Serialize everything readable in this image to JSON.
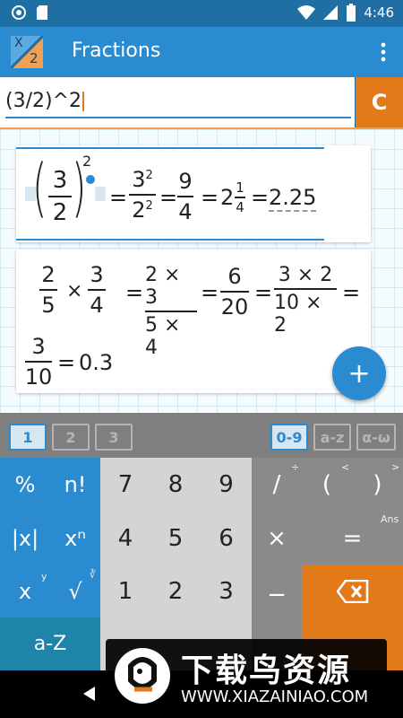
{
  "status": {
    "time": "4:46"
  },
  "app": {
    "title": "Fractions",
    "logo_x": "X",
    "logo_2": "2"
  },
  "input": {
    "value": "(3/2)^2",
    "clear_label": "C"
  },
  "result1": {
    "base_num": "3",
    "base_den": "2",
    "power": "2",
    "eq": "=",
    "step1_num_base": "3",
    "step1_num_pow": "2",
    "step1_den_base": "2",
    "step1_den_pow": "2",
    "step2_num": "9",
    "step2_den": "4",
    "mixed_whole": "2",
    "mixed_num": "1",
    "mixed_den": "4",
    "decimal": "2.25"
  },
  "result2": {
    "a_num": "2",
    "a_den": "5",
    "times": "×",
    "b_num": "3",
    "b_den": "4",
    "c_num": "2 × 3",
    "c_den": "5 × 4",
    "d_num": "6",
    "d_den": "20",
    "e_num": "3 × 2",
    "e_den": "10 × 2",
    "f_num": "3",
    "f_den": "10",
    "eq": "=",
    "decimal": "0.3"
  },
  "fab": {
    "label": "+"
  },
  "tabs": {
    "left": [
      "1",
      "2",
      "3"
    ],
    "right": [
      "0-9",
      "a-z",
      "α-ω"
    ]
  },
  "keys": {
    "percent": "%",
    "factorial": "n!",
    "abs": "|x|",
    "power": "xⁿ",
    "x": "x",
    "sqrt": "√",
    "sqrt_hint_y": "y",
    "sqrt_hint": "∛",
    "az": "a-Z",
    "d7": "7",
    "d8": "8",
    "d9": "9",
    "d4": "4",
    "d5": "5",
    "d6": "6",
    "d1": "1",
    "d2": "2",
    "d3": "3",
    "divide": "/",
    "divide_hint": "÷",
    "lparen": "(",
    "lparen_hint": "<",
    "rparen": ")",
    "rparen_hint": ">",
    "multiply": "×",
    "equals": "=",
    "ans_hint": "Ans",
    "minus": "−"
  },
  "watermark": {
    "title": "下载鸟资源",
    "url": "WWW.XIAZAINIAO.COM"
  },
  "colors": {
    "primary": "#2a8bd1",
    "primary_dark": "#1f6fa4",
    "accent": "#e27a1a"
  }
}
